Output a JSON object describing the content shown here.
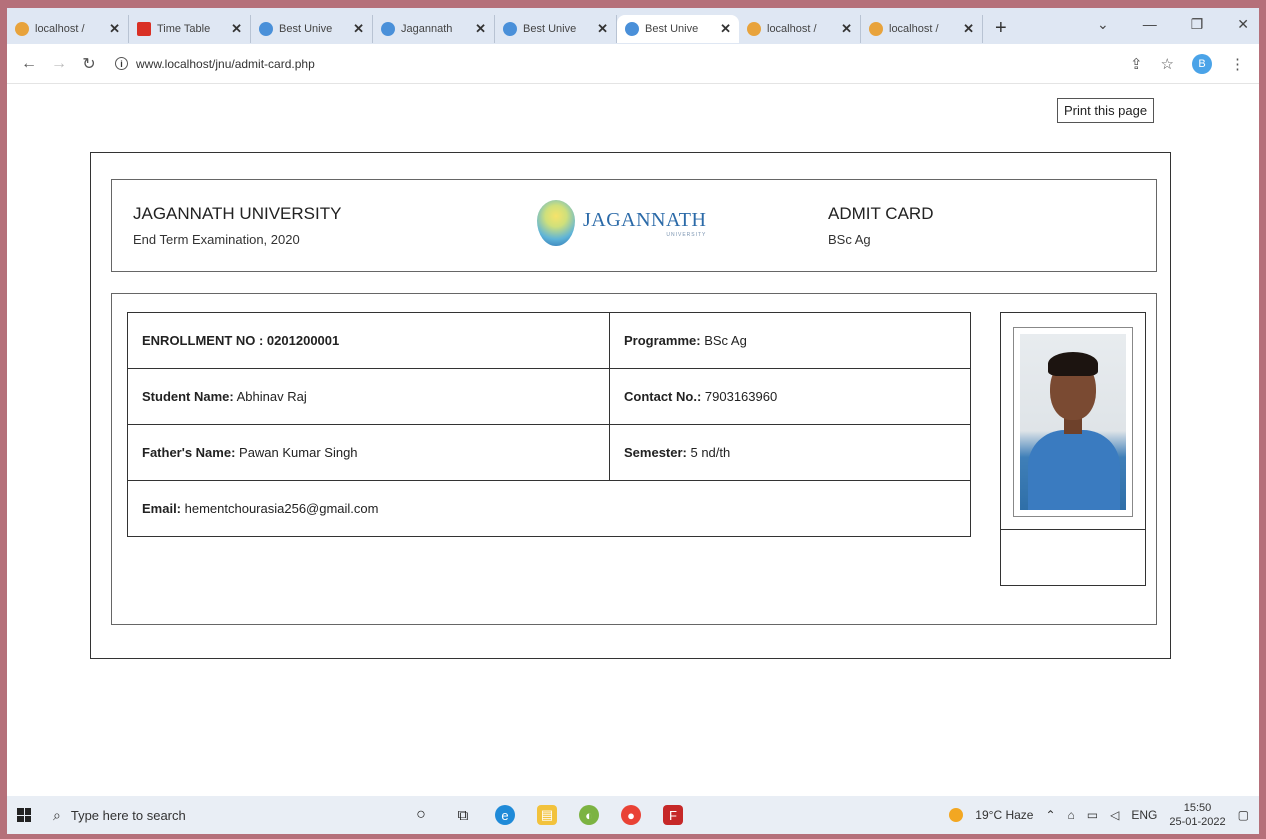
{
  "browser": {
    "tabs": [
      {
        "title": "localhost /",
        "icon": "phpmyadmin-icon",
        "color": "#e8a33c",
        "active": false
      },
      {
        "title": "Time Table",
        "icon": "gmail-icon",
        "color": "#d93025",
        "active": false
      },
      {
        "title": "Best Unive",
        "icon": "globe-icon",
        "color": "#4a90d9",
        "active": false
      },
      {
        "title": "Jagannath",
        "icon": "globe-icon",
        "color": "#4a90d9",
        "active": false
      },
      {
        "title": "Best Unive",
        "icon": "globe-icon",
        "color": "#4a90d9",
        "active": false
      },
      {
        "title": "Best Unive",
        "icon": "globe-icon",
        "color": "#4a90d9",
        "active": true
      },
      {
        "title": "localhost /",
        "icon": "phpmyadmin-icon",
        "color": "#e8a33c",
        "active": false
      },
      {
        "title": "localhost /",
        "icon": "phpmyadmin-icon",
        "color": "#e8a33c",
        "active": false
      }
    ],
    "url": "www.localhost/jnu/admit-card.php",
    "profile_initial": "B"
  },
  "page": {
    "print_tooltip": "Print this page",
    "university_name": "JAGANNATH UNIVERSITY",
    "exam_name": "End Term Examination, 2020",
    "logo_text": "JAGANNATH",
    "logo_subtext": "UNIVERSITY",
    "card_title": "ADMIT CARD",
    "card_programme": "BSc Ag",
    "fields": {
      "enrollment": {
        "label": "ENROLLMENT NO : 0201200001",
        "value": ""
      },
      "programme": {
        "label": "Programme:",
        "value": " BSc Ag"
      },
      "student_name": {
        "label": "Student Name:",
        "value": " Abhinav Raj"
      },
      "contact": {
        "label": "Contact No.:",
        "value": " 7903163960"
      },
      "father_name": {
        "label": "Father's Name:",
        "value": " Pawan Kumar Singh"
      },
      "semester": {
        "label": "Semester:",
        "value": " 5 nd/th"
      },
      "email": {
        "label": "Email:",
        "value": " hementchourasia256@gmail.com"
      }
    }
  },
  "taskbar": {
    "search_placeholder": "Type here to search",
    "weather": "19°C Haze",
    "language": "ENG",
    "time": "15:50",
    "date": "25-01-2022"
  }
}
